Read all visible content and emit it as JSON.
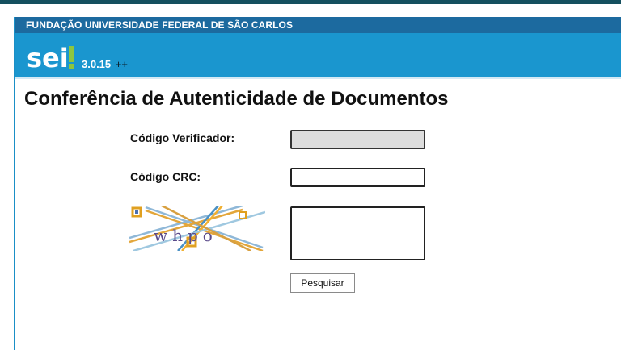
{
  "header": {
    "org_name": "FUNDAÇÃO UNIVERSIDADE FEDERAL DE SÃO CARLOS",
    "logo_text": "sei",
    "version": "3.0.15",
    "version_suffix": "++"
  },
  "page": {
    "title": "Conferência de Autenticidade de Documentos"
  },
  "form": {
    "verifier_label": "Código Verificador:",
    "verifier_value": "",
    "crc_label": "Código CRC:",
    "crc_value": "",
    "captcha_text": "whpo",
    "captcha_value": "",
    "search_button": "Pesquisar"
  },
  "colors": {
    "header_dark": "#1c6a9f",
    "header_blue": "#1a96cf",
    "top_strip": "#15505f"
  }
}
